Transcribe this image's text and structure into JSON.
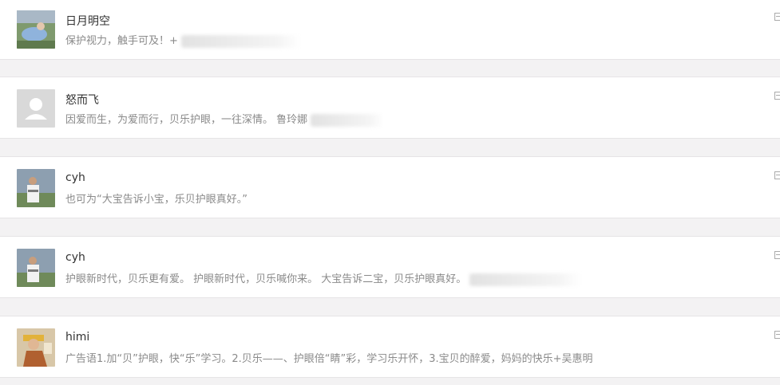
{
  "comments": [
    {
      "name": "日月明空",
      "text": "保护视力，触手可及！+",
      "redacted": true,
      "avatar": "avatar-photo-outdoor"
    },
    {
      "name": "怒而飞",
      "text": "因爱而生，为爱而行，贝乐护眼，一往深情。 鲁玲娜",
      "redacted": true,
      "avatar": "avatar-default-placeholder"
    },
    {
      "name": "cyh",
      "text": "也可为“大宝告诉小宝，乐贝护眼真好。”",
      "redacted": false,
      "avatar": "avatar-photo-man"
    },
    {
      "name": "cyh",
      "text": "护眼新时代，贝乐更有爱。 护眼新时代，贝乐喊你来。 大宝告诉二宝，贝乐护眼真好。",
      "redacted": true,
      "avatar": "avatar-photo-man"
    },
    {
      "name": "himi",
      "text": "广告语1.加“贝”护眼，快“乐”学习。2.贝乐——、护眼倍“睛”彩，学习乐开怀，3.宝贝的醉爱，妈妈的快乐+吴惠明",
      "redacted": false,
      "avatar": "avatar-photo-yellow"
    }
  ],
  "colors": {
    "name": "#333333",
    "text": "#8a8a8a",
    "card": "#ffffff",
    "page": "#f3f2f3"
  }
}
